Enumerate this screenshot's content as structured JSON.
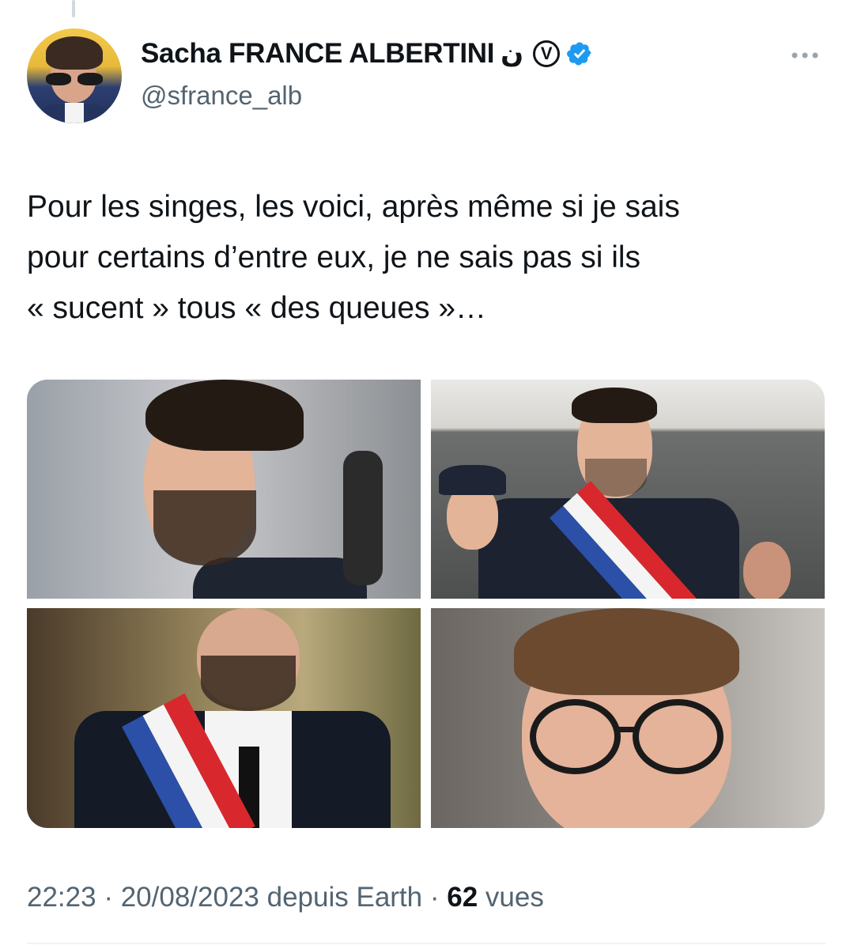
{
  "author": {
    "display_name": "Sacha FRANCE ALBERTINI",
    "name_symbol": "ن",
    "name_badge": "V",
    "handle": "@sfrance_alb",
    "verified": true
  },
  "tweet": {
    "text": "Pour les singes, les voici, après même si je sais\npour certains d’entre eux, je ne sais pas si ils\n« sucent » tous « des queues »…",
    "media_count": 4
  },
  "meta": {
    "time": "22:23",
    "date": "20/08/2023",
    "source": "depuis Earth",
    "views_count": "62",
    "views_label": "vues"
  },
  "colors": {
    "text": "#0f1419",
    "secondary": "#536471",
    "verified": "#1d9bf0",
    "divider": "#eff3f4"
  },
  "icons": {
    "more": "more-horizontal-icon",
    "verified": "verified-badge-icon"
  }
}
